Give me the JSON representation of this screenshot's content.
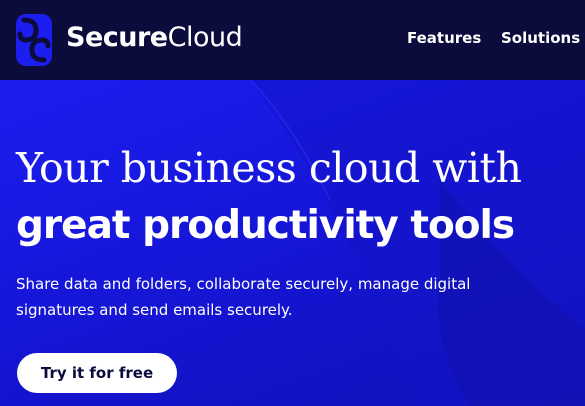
{
  "header": {
    "brand_bold": "Secure",
    "brand_regular": "Cloud",
    "nav": [
      {
        "label": "Features"
      },
      {
        "label": "Solutions"
      }
    ]
  },
  "hero": {
    "headline_line1": "Your business cloud with",
    "headline_line2": "great productivity tools",
    "subtext": "Share data and folders, collaborate securely, manage digital signatures and send emails securely.",
    "cta_label": "Try it for free"
  },
  "colors": {
    "nav_background": "#0b0c3b",
    "hero_blue": "#1c1ef0",
    "button_background": "#ffffff",
    "button_text": "#0b0c3b"
  },
  "icons": {
    "logo": "securecloud-logo-icon"
  }
}
